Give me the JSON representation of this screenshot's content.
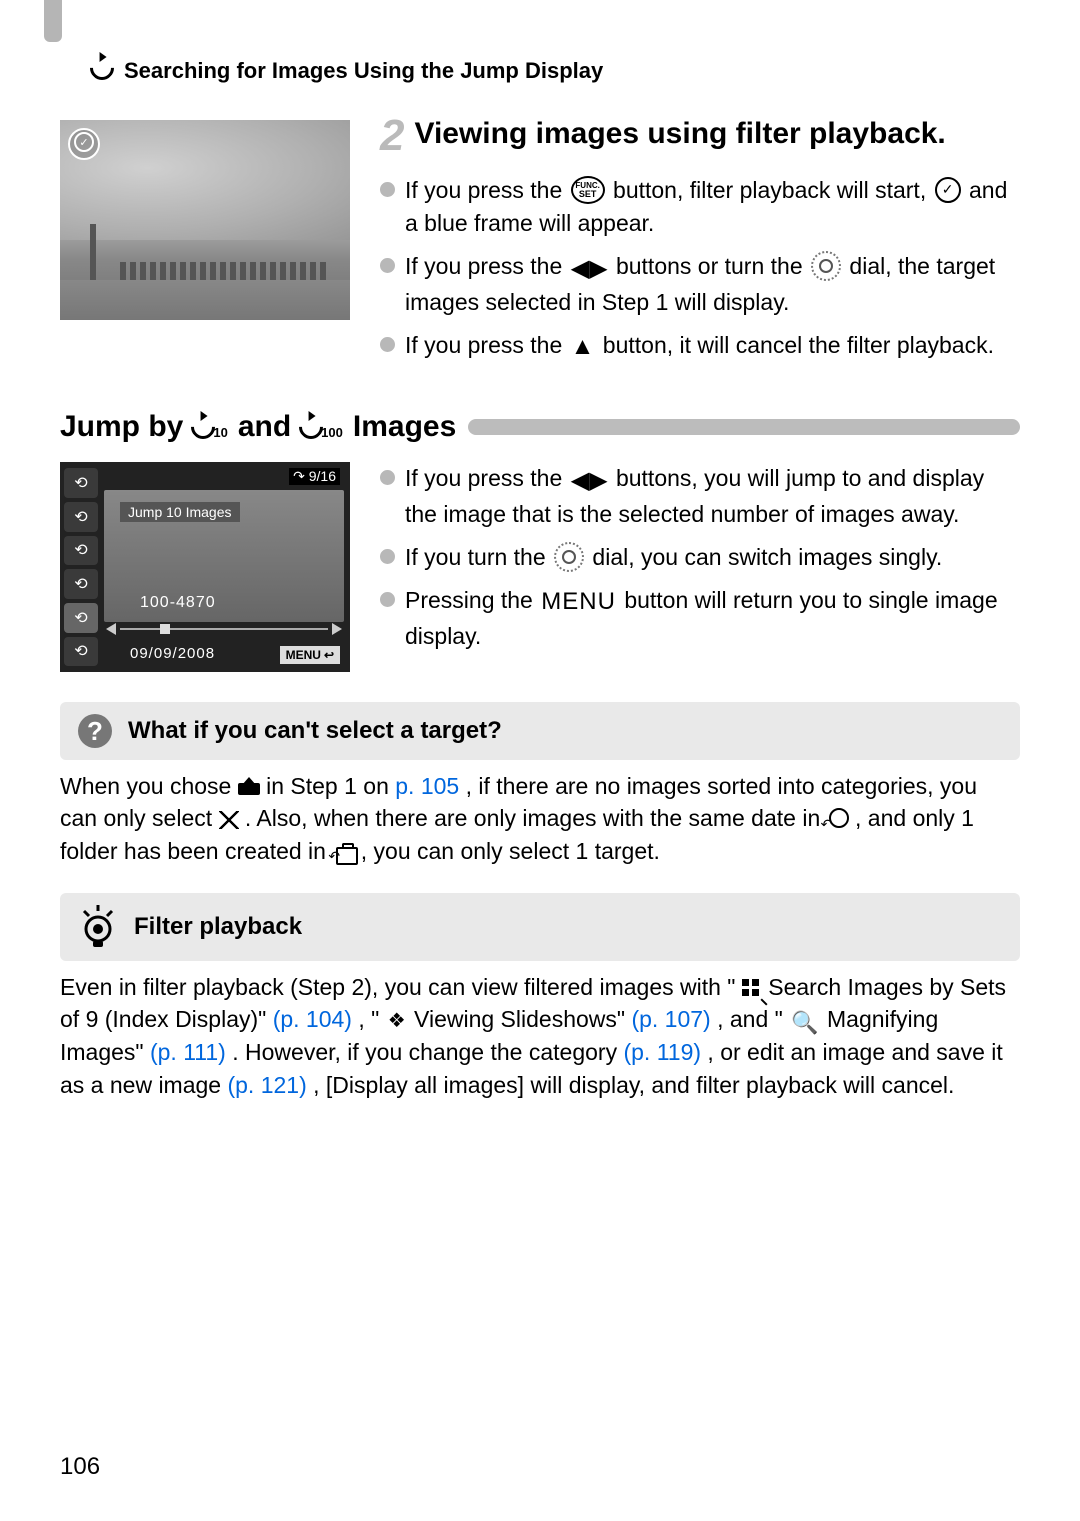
{
  "header": {
    "title": "Searching for Images Using the Jump Display"
  },
  "step2": {
    "number": "2",
    "title": "Viewing images using filter playback.",
    "bullets": [
      {
        "pre": "If you press the ",
        "mid": " button, filter playback will start, ",
        "post": " and a blue frame will appear."
      },
      {
        "pre": "If you press the ",
        "mid": " buttons or turn the ",
        "post": " dial, the target images selected in Step 1 will display."
      },
      {
        "pre": "If you press the ",
        "mid": " button, it will cancel the filter playback.",
        "post": ""
      }
    ]
  },
  "jump_section": {
    "title_pre": "Jump by ",
    "title_mid": " and ",
    "title_post": " Images",
    "sub10": "10",
    "sub100": "100",
    "bullets": [
      {
        "pre": "If you press the ",
        "post": " buttons, you will jump to and display the image that is the selected number of images away."
      },
      {
        "pre": "If you turn the ",
        "post": " dial, you can switch images singly."
      },
      {
        "pre": "Pressing the ",
        "post": " button will return you to single image display."
      }
    ],
    "ui": {
      "counter_prefix": "↷ ",
      "counter": "9/16",
      "jump_label": "Jump 10 Images",
      "file_number": "100-4870",
      "date": "09/09/2008",
      "menu_btn": "MENU"
    }
  },
  "tip1": {
    "title": "What if you can't select a target?",
    "body_a": "When you chose ",
    "body_b": " in Step 1 on ",
    "link1": "p. 105",
    "body_c": ", if there are no images sorted into categories, you can only select ",
    "body_d": ". Also, when there are only images with the same date in ",
    "body_e": ", and only 1 folder has been created in ",
    "body_f": ", you can only select 1 target."
  },
  "tip2": {
    "title": "Filter playback",
    "body_a": "Even in filter playback (Step 2), you can view filtered images with \"",
    "body_b": " Search Images by Sets of 9 (Index Display)\" ",
    "link1": "(p. 104)",
    "body_c": ", \"",
    "body_d": " Viewing Slideshows\" ",
    "link2": "(p. 107)",
    "body_e": ", and \"",
    "body_f": " Magnifying Images\" ",
    "link3": "(p. 111)",
    "body_g": ". However, if you change the category ",
    "link4": "(p. 119)",
    "body_h": ", or edit an image and save it as a new image ",
    "link5": "(p. 121)",
    "body_i": ", [Display all images] will display, and filter playback will cancel."
  },
  "page_number": "106",
  "icons": {
    "func": "FUNC.",
    "set": "SET",
    "menu": "MENU"
  }
}
